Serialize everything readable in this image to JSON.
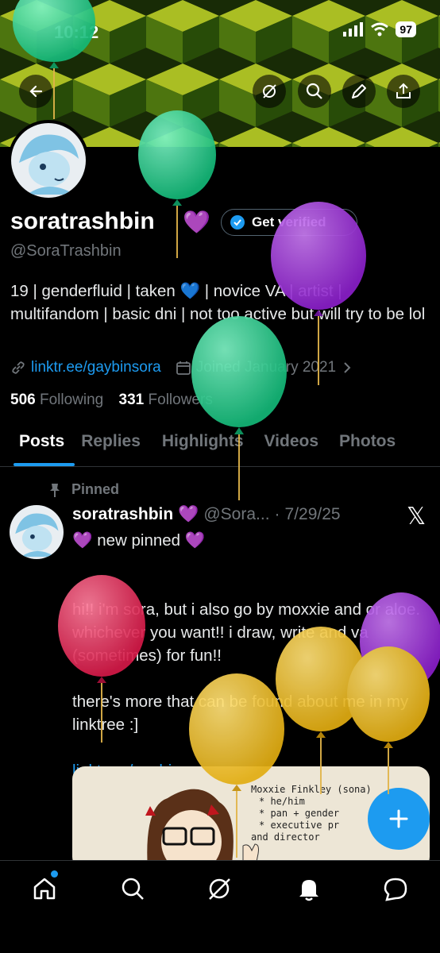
{
  "status_bar": {
    "time": "10:12",
    "battery": "97"
  },
  "profile": {
    "display_name": "soratrashbin",
    "name_emoji": "💜",
    "verify_label": "Get verified",
    "handle": "@SoraTrashbin",
    "bio": "19 | genderfluid | taken 💙 | novice VA | artist | multifandom | basic dni | not too active but will try to be lol",
    "link": "linktr.ee/gaybinsora",
    "joined": "Joined January 2021",
    "following_count": "506",
    "following_label": "Following",
    "followers_count": "331",
    "followers_label": "Followers"
  },
  "tabs": [
    "Posts",
    "Replies",
    "Highlights",
    "Videos",
    "Photos"
  ],
  "post": {
    "pinned_label": "Pinned",
    "author_name": "soratrashbin",
    "author_emoji": "💜",
    "author_handle": "@Sora...",
    "dot": "·",
    "date": "7/29/25",
    "line1": "💜 new pinned 💜",
    "para1": "hi!! i'm sora, but i also go by moxxie and or aloe. whichever you want!! i draw, write and va (sometimes) for fun!!",
    "para2": "there's more that can be found about me in my linktree :]",
    "link": "linktr.ee/gaybinsora",
    "media_text": [
      "Moxxie Finkley (sona)",
      "* he/him",
      "* pan + gender",
      "* executive pr",
      "and director"
    ]
  },
  "nav": [
    "home-icon",
    "search-icon",
    "grok-icon",
    "bell-icon",
    "messages-icon"
  ],
  "colors": {
    "accent": "#1d9bf0",
    "background": "#000000",
    "muted": "#71767b"
  }
}
